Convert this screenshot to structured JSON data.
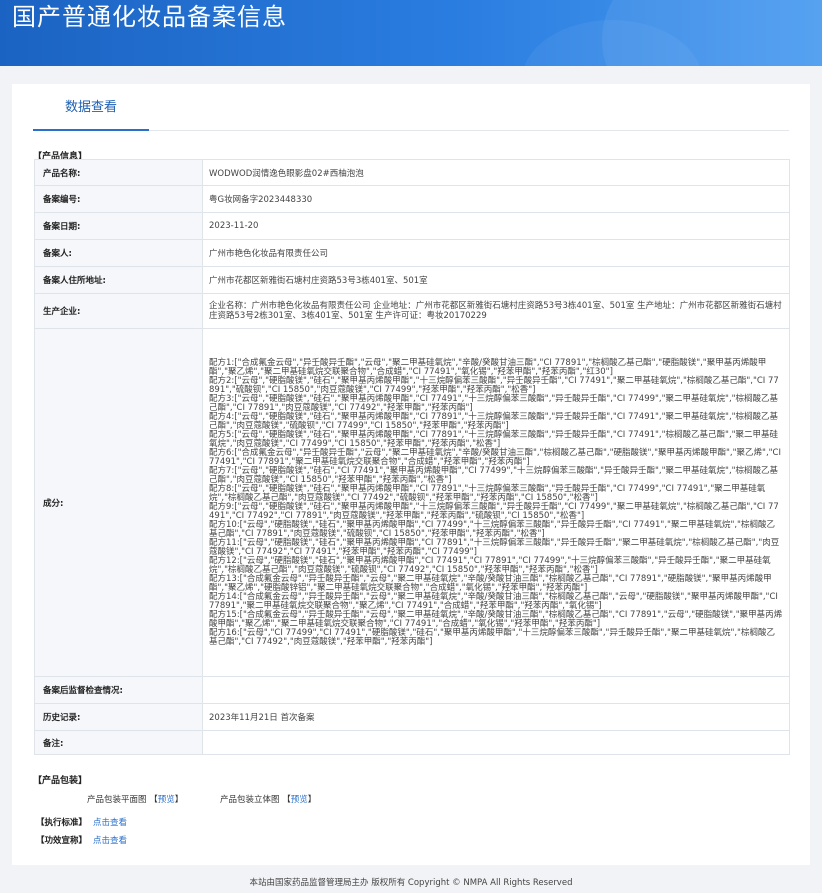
{
  "banner": {
    "title": "国产普通化妆品备案信息"
  },
  "tabs": {
    "active": "数据查看"
  },
  "product_info": {
    "section_title": "【产品信息】",
    "rows": [
      {
        "label": "产品名称:",
        "value": "WODWOD润情逸色眼影盘02#西柚泡泡"
      },
      {
        "label": "备案编号:",
        "value": "粤G妆网备字2023448330"
      },
      {
        "label": "备案日期:",
        "value": "2023-11-20"
      },
      {
        "label": "备案人:",
        "value": "广州市艳色化妆品有限责任公司"
      },
      {
        "label": "备案人住所地址:",
        "value": "广州市花都区新雅街石塘村庄资路53号3栋401室、501室"
      },
      {
        "label": "生产企业:",
        "value": "企业名称：广州市艳色化妆品有限责任公司 企业地址：广州市花都区新雅街石塘村庄资路53号3栋401室、501室 生产地址：广州市花都区新雅街石塘村庄资路53号2栋301室、3栋401室、501室 生产许可证：粤妆20170229"
      },
      {
        "label": "成分:",
        "value": "配方1:[\"合成氟金云母\",\"异壬酸异壬酯\",\"云母\",\"聚二甲基硅氧烷\",\"辛酸/癸酸甘油三酯\",\"CI 77891\",\"棕榈酸乙基己酯\",\"硬脂酸镁\",\"聚甲基丙烯酸甲酯\",\"聚乙烯\",\"聚二甲基硅氧烷交联聚合物\",\"合成蜡\",\"CI 77491\",\"氧化锡\",\"羟苯甲酯\",\"羟苯丙酯\",\"红30\"]\n配方2:[\"云母\",\"硬脂酸镁\",\"硅石\",\"聚甲基丙烯酸甲酯\",\"十三烷醇偏苯三酸酯\",\"异壬酸异壬酯\",\"CI 77491\",\"聚二甲基硅氧烷\",\"棕榈酸乙基己酯\",\"CI 77891\",\"硫酸钡\",\"CI 15850\",\"肉豆蔻酸镁\",\"CI 77499\",\"羟苯甲酯\",\"羟苯丙酯\",\"松香\"]\n配方3:[\"云母\",\"硬脂酸镁\",\"硅石\",\"聚甲基丙烯酸甲酯\",\"CI 77491\",\"十三烷醇偏苯三酸酯\",\"异壬酸异壬酯\",\"CI 77499\",\"聚二甲基硅氧烷\",\"棕榈酸乙基己酯\",\"CI 77891\",\"肉豆蔻酸镁\",\"CI 77492\",\"羟苯甲酯\",\"羟苯丙酯\"]\n配方4:[\"云母\",\"硬脂酸镁\",\"硅石\",\"聚甲基丙烯酸甲酯\",\"CI 77891\",\"十三烷醇偏苯三酸酯\",\"异壬酸异壬酯\",\"CI 77491\",\"聚二甲基硅氧烷\",\"棕榈酸乙基己酯\",\"肉豆蔻酸镁\",\"硫酸钡\",\"CI 77499\",\"CI 15850\",\"羟苯甲酯\",\"羟苯丙酯\"]\n配方5:[\"云母\",\"硬脂酸镁\",\"硅石\",\"聚甲基丙烯酸甲酯\",\"CI 77891\",\"十三烷醇偏苯三酸酯\",\"异壬酸异壬酯\",\"CI 77491\",\"棕榈酸乙基己酯\",\"聚二甲基硅氧烷\",\"肉豆蔻酸镁\",\"CI 77499\",\"CI 15850\",\"羟苯甲酯\",\"羟苯丙酯\",\"松香\"]\n配方6:[\"合成氟金云母\",\"异壬酸异壬酯\",\"云母\",\"聚二甲基硅氧烷\",\"辛酸/癸酸甘油三酯\",\"棕榈酸乙基己酯\",\"硬脂酸镁\",\"聚甲基丙烯酸甲酯\",\"聚乙烯\",\"CI 77491\",\"CI 77891\",\"聚二甲基硅氧烷交联聚合物\",\"合成蜡\",\"羟苯甲酯\",\"羟苯丙酯\"]\n配方7:[\"云母\",\"硬脂酸镁\",\"硅石\",\"CI 77491\",\"聚甲基丙烯酸甲酯\",\"CI 77499\",\"十三烷醇偏苯三酸酯\",\"异壬酸异壬酯\",\"聚二甲基硅氧烷\",\"棕榈酸乙基己酯\",\"肉豆蔻酸镁\",\"CI 15850\",\"羟苯甲酯\",\"羟苯丙酯\",\"松香\"]\n配方8:[\"云母\",\"硬脂酸镁\",\"硅石\",\"聚甲基丙烯酸甲酯\",\"CI 77891\",\"十三烷醇偏苯三酸酯\",\"异壬酸异壬酯\",\"CI 77499\",\"CI 77491\",\"聚二甲基硅氧烷\",\"棕榈酸乙基己酯\",\"肉豆蔻酸镁\",\"CI 77492\",\"硫酸钡\",\"羟苯甲酯\",\"羟苯丙酯\",\"CI 15850\",\"松香\"]\n配方9:[\"云母\",\"硬脂酸镁\",\"硅石\",\"聚甲基丙烯酸甲酯\",\"十三烷醇偏苯三酸酯\",\"异壬酸异壬酯\",\"CI 77499\",\"聚二甲基硅氧烷\",\"棕榈酸乙基己酯\",\"CI 77491\",\"CI 77492\",\"CI 77891\",\"肉豆蔻酸镁\",\"羟苯甲酯\",\"羟苯丙酯\",\"硫酸钡\",\"CI 15850\",\"松香\"]\n配方10:[\"云母\",\"硬脂酸镁\",\"硅石\",\"聚甲基丙烯酸甲酯\",\"CI 77499\",\"十三烷醇偏苯三酸酯\",\"异壬酸异壬酯\",\"CI 77491\",\"聚二甲基硅氧烷\",\"棕榈酸乙基己酯\",\"CI 77891\",\"肉豆蔻酸镁\",\"硫酸钡\",\"CI 15850\",\"羟苯甲酯\",\"羟苯丙酯\",\"松香\"]\n配方11:[\"云母\",\"硬脂酸镁\",\"硅石\",\"聚甲基丙烯酸甲酯\",\"CI 77891\",\"十三烷醇偏苯三酸酯\",\"异壬酸异壬酯\",\"聚二甲基硅氧烷\",\"棕榈酸乙基己酯\",\"肉豆蔻酸镁\",\"CI 77492\",\"CI 77491\",\"羟苯甲酯\",\"羟苯丙酯\",\"CI 77499\"]\n配方12:[\"云母\",\"硬脂酸镁\",\"硅石\",\"聚甲基丙烯酸甲酯\",\"CI 77491\",\"CI 77891\",\"CI 77499\",\"十三烷醇偏苯三酸酯\",\"异壬酸异壬酯\",\"聚二甲基硅氧烷\",\"棕榈酸乙基己酯\",\"肉豆蔻酸镁\",\"硫酸钡\",\"CI 77492\",\"CI 15850\",\"羟苯甲酯\",\"羟苯丙酯\",\"松香\"]\n配方13:[\"合成氟金云母\",\"异壬酸异壬酯\",\"云母\",\"聚二甲基硅氧烷\",\"辛酸/癸酸甘油三酯\",\"棕榈酸乙基己酯\",\"CI 77891\",\"硬脂酸镁\",\"聚甲基丙烯酸甲酯\",\"聚乙烯\",\"硬脂酸锌铝\",\"聚二甲基硅氧烷交联聚合物\",\"合成蜡\",\"氧化锡\",\"羟苯甲酯\",\"羟苯丙酯\"]\n配方14:[\"合成氟金云母\",\"异壬酸异壬酯\",\"云母\",\"聚二甲基硅氧烷\",\"辛酸/癸酸甘油三酯\",\"棕榈酸乙基己酯\",\"云母\",\"硬脂酸镁\",\"聚甲基丙烯酸甲酯\",\"CI 77891\",\"聚二甲基硅氧烷交联聚合物\",\"聚乙烯\",\"CI 77491\",\"合成蜡\",\"羟苯甲酯\",\"羟苯丙酯\",\"氧化锡\"]\n配方15:[\"合成氟金云母\",\"异壬酸异壬酯\",\"云母\",\"聚二甲基硅氧烷\",\"辛酸/癸酸甘油三酯\",\"棕榈酸乙基己酯\",\"CI 77891\",\"云母\",\"硬脂酸镁\",\"聚甲基丙烯酸甲酯\",\"聚乙烯\",\"聚二甲基硅氧烷交联聚合物\",\"CI 77491\",\"合成蜡\",\"氧化锡\",\"羟苯甲酯\",\"羟苯丙酯\"]\n配方16:[\"云母\",\"CI 77499\",\"CI 77491\",\"硬脂酸镁\",\"硅石\",\"聚甲基丙烯酸甲酯\",\"十三烷醇偏苯三酸酯\",\"异壬酸异壬酯\",\"聚二甲基硅氧烷\",\"棕榈酸乙基己酯\",\"CI 77492\",\"肉豆蔻酸镁\",\"羟苯甲酯\",\"羟苯丙酯\"]"
      },
      {
        "label": "备案后监督检查情况:",
        "value": ""
      },
      {
        "label": "历史记录:",
        "value": "2023年11月21日 首次备案"
      },
      {
        "label": "备注:",
        "value": ""
      }
    ]
  },
  "packaging": {
    "section_title": "【产品包装】",
    "flat_label": "产品包装平面图",
    "flat_link": "预览",
    "solid_label": "产品包装立体图",
    "solid_link": "预览",
    "bracket_open": "【",
    "bracket_close": "】"
  },
  "standards": {
    "label": "【执行标准】",
    "link": "点击查看"
  },
  "efficacy": {
    "label": "【功效宣称】",
    "link": "点击查看"
  },
  "footer": {
    "text": "本站由国家药品监督管理局主办 版权所有 Copyright © NMPA All Rights Reserved"
  },
  "colors": {
    "banner": "#2a7de0",
    "link": "#2a6fc9",
    "tab_accent": "#1e5fb3"
  }
}
